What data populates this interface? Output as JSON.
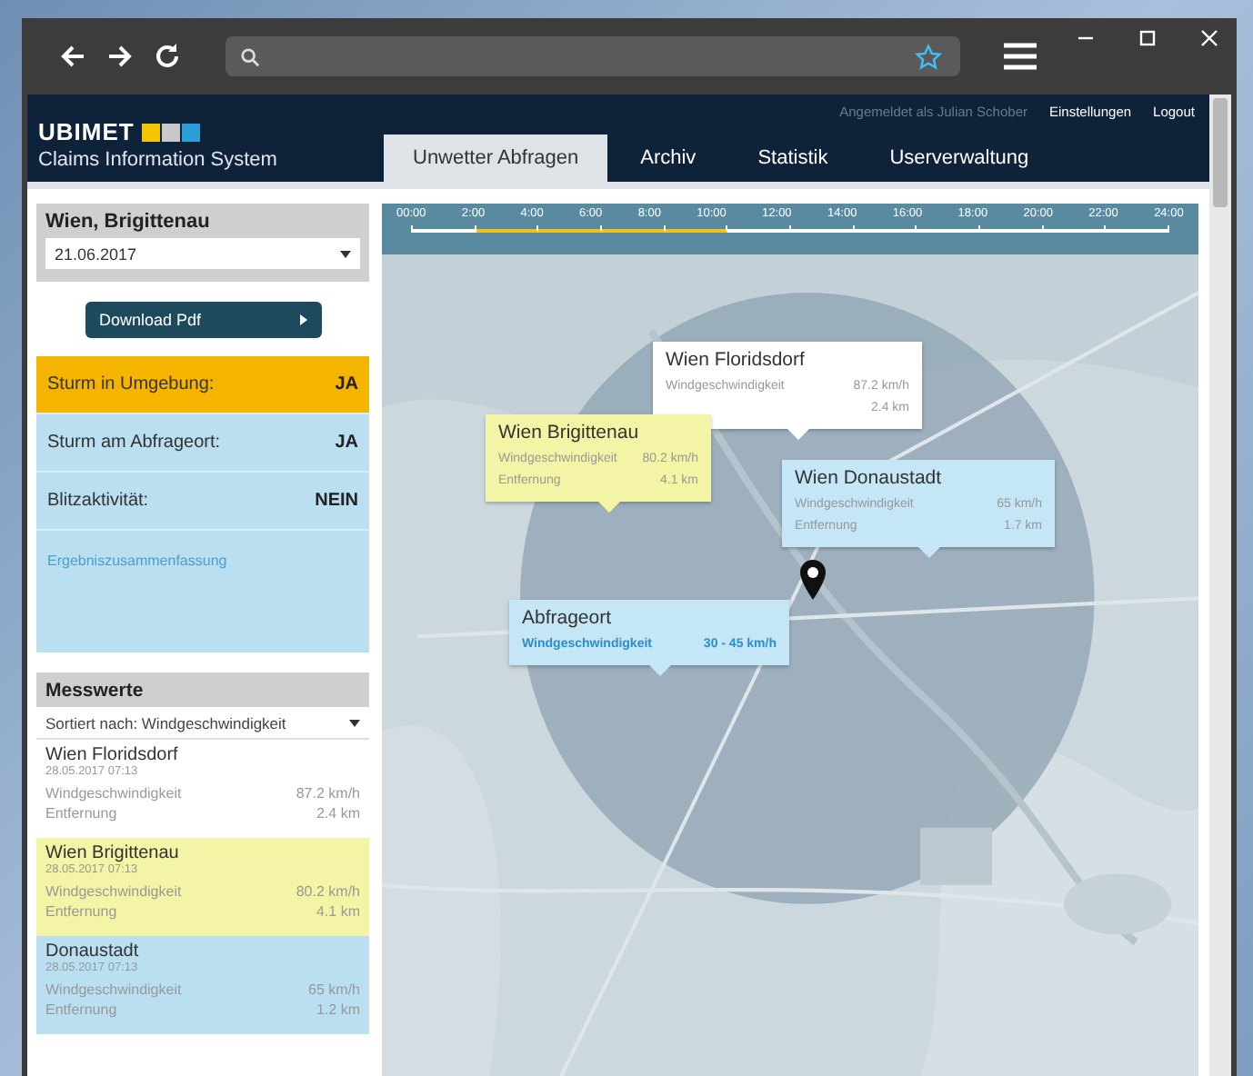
{
  "app": {
    "logo": "UBIMET",
    "subtitle": "Claims Information System",
    "user": "Angemeldet als Julian Schober",
    "links": [
      "Einstellungen",
      "Logout"
    ]
  },
  "tabs": [
    {
      "label": "Unwetter Abfragen",
      "selected": true
    },
    {
      "label": "Archiv",
      "selected": false
    },
    {
      "label": "Statistik",
      "selected": false
    },
    {
      "label": "Userverwaltung",
      "selected": false
    }
  ],
  "location": {
    "title": "Wien, Brigittenau",
    "date": "21.06.2017"
  },
  "download_button": "Download Pdf",
  "status_rows": [
    {
      "label": "Sturm in Umgebung:",
      "value": "JA",
      "color": "#f5b400"
    },
    {
      "label": "Sturm am Abfrageort:",
      "value": "JA",
      "color": "#b9dff0"
    },
    {
      "label": "Blitzaktivität:",
      "value": "NEIN",
      "color": "#b9dff0"
    }
  ],
  "summary_link": "Ergebniszusammenfassung",
  "measurements": {
    "title": "Messwerte",
    "sort": "Sortiert nach: Windgeschwindigkeit",
    "items": [
      {
        "name": "Wien Floridsdorf",
        "time": "28.05.2017 07:13",
        "rows": [
          {
            "label": "Windgeschwindigkeit",
            "value": "87.2 km/h"
          },
          {
            "label": "Entfernung",
            "value": "2.4 km"
          }
        ],
        "color": "#ffffff"
      },
      {
        "name": "Wien Brigittenau",
        "time": "28.05.2017 07:13",
        "rows": [
          {
            "label": "Windgeschwindigkeit",
            "value": "80.2 km/h"
          },
          {
            "label": "Entfernung",
            "value": "4.1 km"
          }
        ],
        "color": "#f4f4a6"
      },
      {
        "name": "Donaustadt",
        "time": "28.05.2017 07:13",
        "rows": [
          {
            "label": "Windgeschwindigkeit",
            "value": "65 km/h"
          },
          {
            "label": "Entfernung",
            "value": "1.2 km"
          }
        ],
        "color": "#b9dff0"
      }
    ]
  },
  "timeline": {
    "ticks": [
      "00:00",
      "2:00",
      "4:00",
      "6:00",
      "8:00",
      "10:00",
      "12:00",
      "14:00",
      "16:00",
      "18:00",
      "20:00",
      "22:00",
      "24:00"
    ],
    "segments": [
      {
        "selected": false
      },
      {
        "selected": true
      },
      {
        "selected": true
      },
      {
        "selected": true
      },
      {
        "selected": true
      },
      {
        "selected": false
      },
      {
        "selected": false
      },
      {
        "selected": false
      },
      {
        "selected": false
      },
      {
        "selected": false
      },
      {
        "selected": false
      },
      {
        "selected": false
      }
    ]
  },
  "map": {
    "callouts": [
      {
        "kind": "station",
        "title": "Wien Floridsdorf",
        "color": "#ffffff",
        "rows": [
          {
            "label": "Windgeschwindigkeit",
            "value": "87.2 km/h"
          },
          {
            "value": "2.4 km"
          }
        ]
      },
      {
        "kind": "station",
        "title": "Wien Brigittenau",
        "color": "#f4f4a6",
        "rows": [
          {
            "label": "Windgeschwindigkeit",
            "value": "80.2 km/h"
          },
          {
            "label": "Entfernung",
            "value": "4.1 km"
          }
        ]
      },
      {
        "kind": "station",
        "title": "Wien Donaustadt",
        "color": "#c4e6f6",
        "rows": [
          {
            "label": "Windgeschwindigkeit",
            "value": "65 km/h"
          },
          {
            "label": "Entfernung",
            "value": "1.7 km"
          }
        ]
      },
      {
        "kind": "query",
        "title": "Abfrageort",
        "color": "#c4e6f6",
        "rows": [
          {
            "label": "Windgeschwindigkeit",
            "value": "30 - 45 km/h"
          }
        ]
      }
    ]
  }
}
